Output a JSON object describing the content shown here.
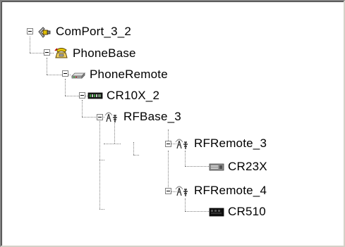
{
  "tree": {
    "nodes": [
      {
        "label": "ComPort_3_2",
        "icon": "comport-icon",
        "expanded": true
      },
      {
        "label": "PhoneBase",
        "icon": "phone-base-icon",
        "expanded": true
      },
      {
        "label": "PhoneRemote",
        "icon": "phone-remote-modem-icon",
        "expanded": true
      },
      {
        "label": "CR10X_2",
        "icon": "datalogger-icon",
        "expanded": true
      },
      {
        "label": "RFBase_3",
        "icon": "radio-antenna-icon",
        "expanded": true
      },
      {
        "label": "RFRemote_3",
        "icon": "radio-antenna-icon",
        "expanded": true
      },
      {
        "label": "CR23X",
        "icon": "datalogger-gray-icon",
        "expanded": null
      },
      {
        "label": "RFRemote_4",
        "icon": "radio-antenna-icon",
        "expanded": true
      },
      {
        "label": "CR510",
        "icon": "datalogger-black-icon",
        "expanded": null
      }
    ]
  }
}
